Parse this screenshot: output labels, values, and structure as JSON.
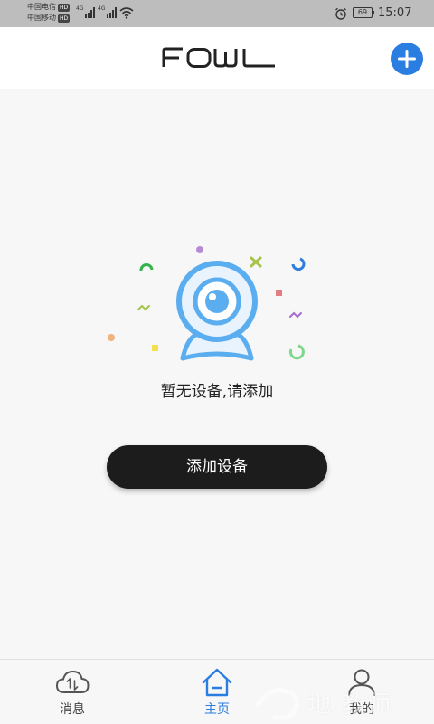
{
  "status_bar": {
    "carrier1": "中国电信",
    "carrier2": "中国移动",
    "hd_badge": "HD",
    "net1": "4G",
    "net2": "4G",
    "battery": "69",
    "time": "15:07"
  },
  "header": {
    "logo_text": "FOWL"
  },
  "empty_state": {
    "message": "暂无设备,请添加"
  },
  "actions": {
    "add_device_label": "添加设备"
  },
  "bottom_nav": {
    "items": [
      {
        "label": "消息",
        "icon": "cloud-icon",
        "active": false
      },
      {
        "label": "主页",
        "icon": "home-icon",
        "active": true
      },
      {
        "label": "我的",
        "icon": "user-icon",
        "active": false
      }
    ]
  },
  "watermark": {
    "text": "地 教师"
  },
  "colors": {
    "accent": "#2a7de1",
    "button_bg": "#1c1c1c",
    "camera_blue": "#5aaef0"
  }
}
